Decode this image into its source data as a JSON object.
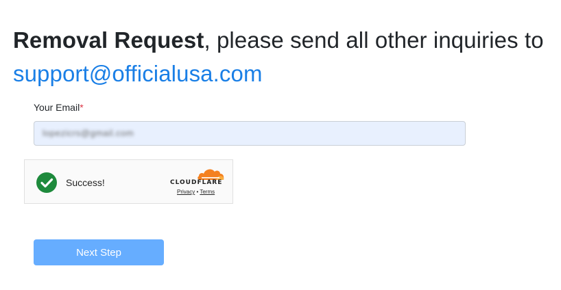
{
  "heading": {
    "bold_text": "Removal Request",
    "rest_text": ", please send all other inquiries to",
    "email_link": "support@officialusa.com"
  },
  "form": {
    "email_label": "Your Email",
    "required_marker": "*",
    "email_value": "lopezicrs@gmail.com"
  },
  "captcha": {
    "status_text": "Success!",
    "brand": "CLOUDFLARE",
    "privacy_link": "Privacy",
    "separator": "•",
    "terms_link": "Terms",
    "check_color": "#1e8a3c",
    "cloud_color": "#f48120"
  },
  "actions": {
    "next_label": "Next Step"
  },
  "colors": {
    "link": "#1a7fe6",
    "button": "#66adff",
    "input_bg": "#e8f0fe"
  }
}
